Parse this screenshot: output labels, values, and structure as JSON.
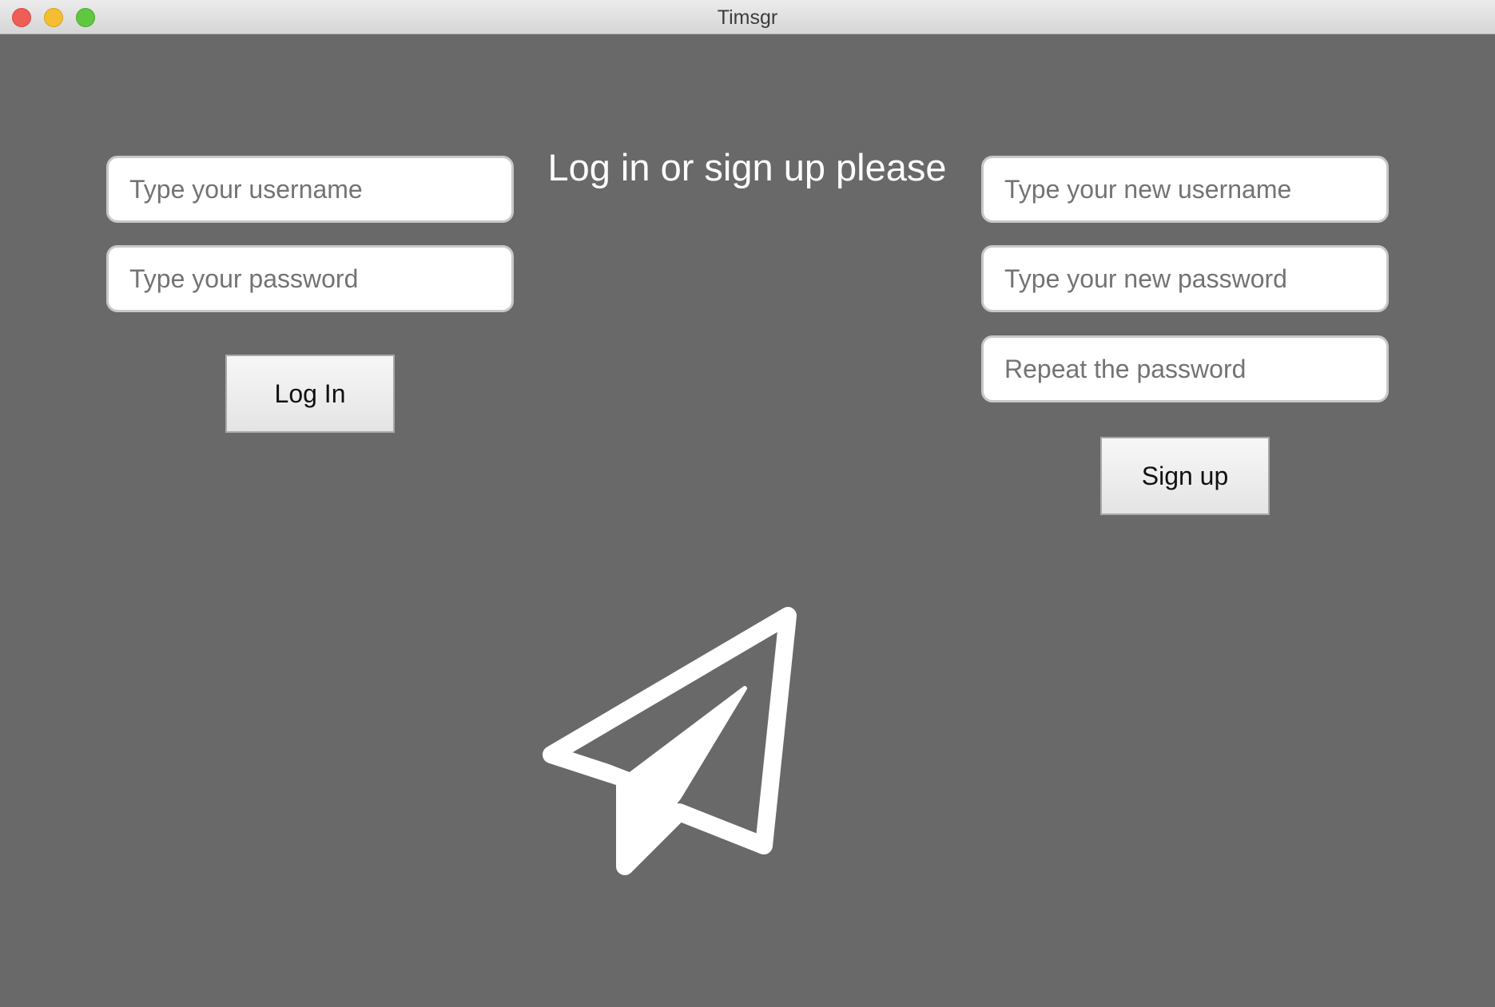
{
  "window": {
    "title": "Timsgr"
  },
  "heading": "Log in or sign up please",
  "login": {
    "username_placeholder": "Type your username",
    "password_placeholder": "Type your password",
    "button_label": "Log In"
  },
  "signup": {
    "username_placeholder": "Type your new username",
    "password_placeholder": "Type your new password",
    "repeat_placeholder": "Repeat the password",
    "button_label": "Sign up"
  },
  "icons": {
    "logo": "paper-plane-icon"
  },
  "colors": {
    "background": "#696969",
    "button": "#eeeeee",
    "field": "#ffffff",
    "heading": "#ffffff",
    "logo": "#ffffff"
  }
}
